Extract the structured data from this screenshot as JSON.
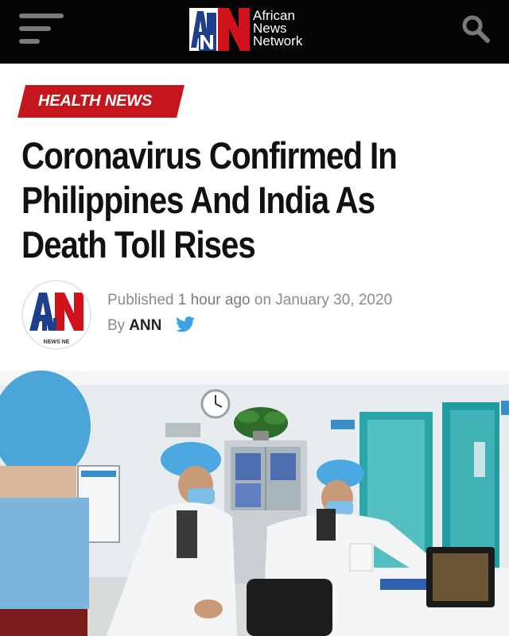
{
  "header": {
    "menu_icon": "hamburger-menu-icon",
    "logo": {
      "mark": "AN",
      "line1": "African",
      "line2": "News",
      "line3": "Network"
    },
    "search_icon": "search-icon"
  },
  "article": {
    "category": "HEALTH NEWS",
    "headline_lines": [
      "Coronavirus Confirmed In",
      "Philippines And India As",
      "Death Toll Rises"
    ],
    "meta": {
      "published_prefix": "Published",
      "relative_time": "1 hour ago",
      "on_word": "on",
      "date": "January 30, 2020",
      "by_word": "By",
      "author": "ANN",
      "share_icon": "twitter-icon"
    },
    "avatar_text": "NEWS NE"
  },
  "colors": {
    "header_bg": "#050505",
    "brand_red": "#d0121b",
    "brand_blue": "#1f3e8c",
    "category_bg": "#c4161c",
    "twitter_blue": "#3aa1e6"
  }
}
